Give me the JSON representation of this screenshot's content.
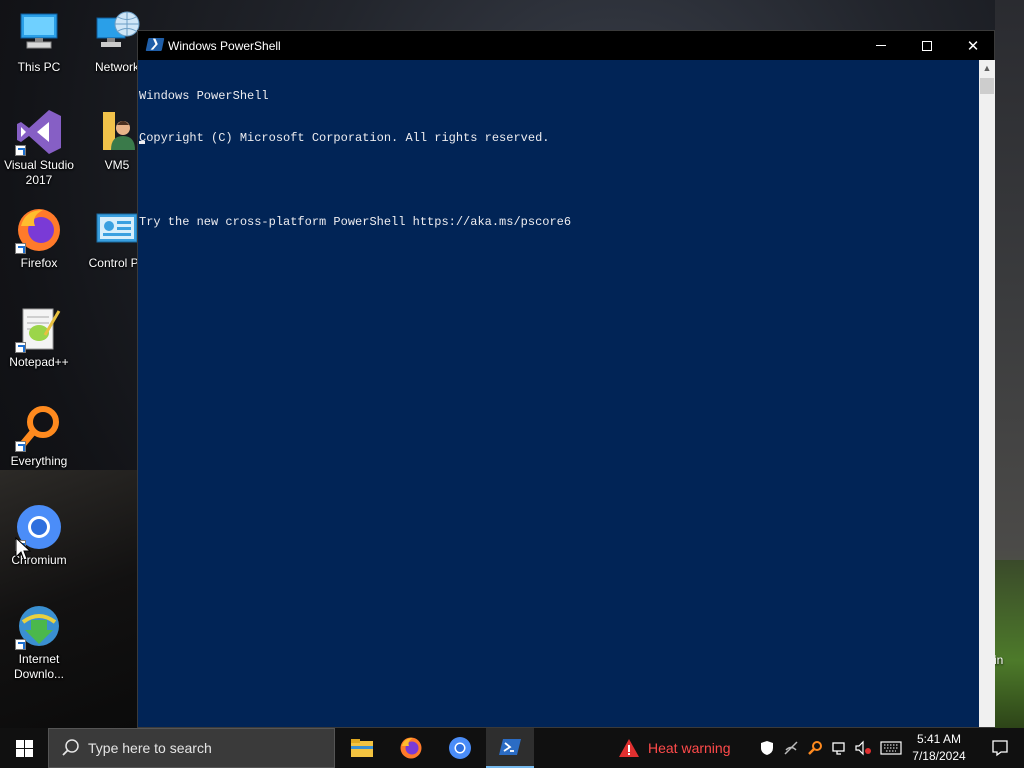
{
  "desktop": {
    "icons": [
      {
        "label": "This PC",
        "icon": "computer-icon"
      },
      {
        "label": "Network",
        "icon": "network-globe-icon"
      },
      {
        "label": "Visual Studio 2017",
        "icon": "visual-studio-icon"
      },
      {
        "label": "VM5",
        "icon": "user-folder-icon"
      },
      {
        "label": "Firefox",
        "icon": "firefox-icon"
      },
      {
        "label": "Control Pa",
        "icon": "control-panel-icon"
      },
      {
        "label": "Notepad++",
        "icon": "notepad-plus-plus-icon"
      },
      {
        "label": "Everything",
        "icon": "everything-search-icon"
      },
      {
        "label": "Chromium",
        "icon": "chromium-icon"
      },
      {
        "label": "Internet Downlo...",
        "icon": "internet-download-manager-icon"
      }
    ],
    "right_edge_text": "in"
  },
  "window": {
    "title": "Windows PowerShell",
    "console_lines": [
      "Windows PowerShell",
      "Copyright (C) Microsoft Corporation. All rights reserved.",
      "",
      "Try the new cross-platform PowerShell https://aka.ms/pscore6"
    ],
    "background_color": "#012456",
    "text_color": "#eeedf0"
  },
  "taskbar": {
    "search_placeholder": "Type here to search",
    "apps": [
      {
        "name": "File Explorer",
        "icon": "file-explorer-icon",
        "active": false
      },
      {
        "name": "Firefox",
        "icon": "firefox-icon",
        "active": false
      },
      {
        "name": "Chromium",
        "icon": "chromium-icon",
        "active": false
      },
      {
        "name": "Windows PowerShell",
        "icon": "powershell-icon",
        "active": true
      }
    ],
    "heat_warning": "Heat warning",
    "heat_color": "#ff4b4b",
    "tray_icons": [
      "windows-security-icon",
      "network-disconnected-icon",
      "everything-tray-icon",
      "network-icon",
      "volume-muted-icon",
      "keyboard-icon"
    ],
    "time": "5:41 AM",
    "date": "7/18/2024"
  }
}
